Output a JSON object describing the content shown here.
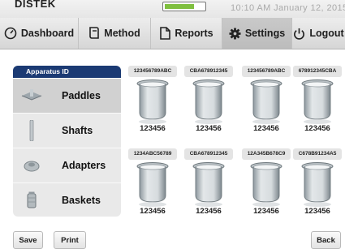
{
  "status": {
    "brand": "DISTEK",
    "datetime": "10:10 AM   January 12, 2015",
    "battery_level": 0.7
  },
  "nav": {
    "tabs": [
      {
        "label": "Dashboard",
        "icon": "gauge-icon"
      },
      {
        "label": "Method",
        "icon": "method-icon"
      },
      {
        "label": "Reports",
        "icon": "document-icon"
      },
      {
        "label": "Settings",
        "icon": "gear-icon",
        "active": true
      },
      {
        "label": "Logout",
        "icon": "power-icon"
      }
    ]
  },
  "sidebar": {
    "header": "Apparatus ID",
    "items": [
      {
        "label": "Paddles",
        "icon": "paddle-icon",
        "selected": true
      },
      {
        "label": "Shafts",
        "icon": "shaft-icon"
      },
      {
        "label": "Adapters",
        "icon": "adapter-icon"
      },
      {
        "label": "Baskets",
        "icon": "basket-icon"
      }
    ]
  },
  "vessels": [
    {
      "id": "123456789ABC",
      "number": "123456"
    },
    {
      "id": "CBA678912345",
      "number": "123456"
    },
    {
      "id": "123456789ABC",
      "number": "123456"
    },
    {
      "id": "678912345CBA",
      "number": "123456"
    },
    {
      "id": "1234ABC56789",
      "number": "123456"
    },
    {
      "id": "CBA678912345",
      "number": "123456"
    },
    {
      "id": "12A345B678C9",
      "number": "123456"
    },
    {
      "id": "C678B91234A5",
      "number": "123456"
    }
  ],
  "footer": {
    "save": "Save",
    "print": "Print",
    "back": "Back"
  },
  "colors": {
    "header_blue": "#1b3a73",
    "battery_green": "#7fbf3f"
  }
}
